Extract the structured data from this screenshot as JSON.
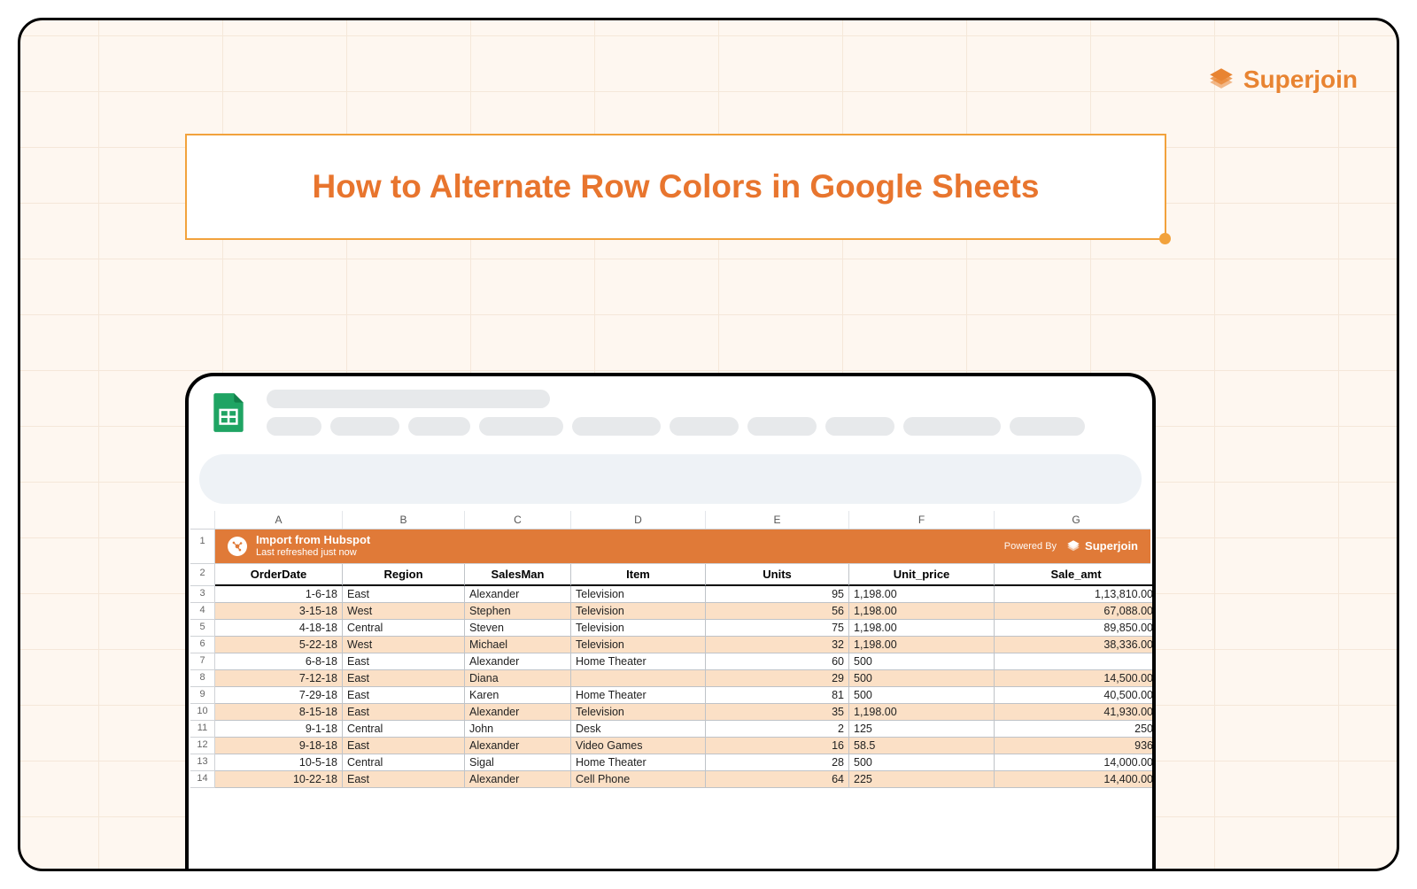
{
  "brand": {
    "name": "Superjoin"
  },
  "title": "How to Alternate Row Colors in Google Sheets",
  "columns": [
    "A",
    "B",
    "C",
    "D",
    "E",
    "F",
    "G"
  ],
  "banner": {
    "title": "Import from Hubspot",
    "subtitle": "Last refreshed just now",
    "powered_label": "Powered By",
    "powered_name": "Superjoin"
  },
  "headers": [
    "OrderDate",
    "Region",
    "SalesMan",
    "Item",
    "Units",
    "Unit_price",
    "Sale_amt"
  ],
  "rows": [
    {
      "n": 3,
      "d": "1-6-18",
      "r": "East",
      "s": "Alexander",
      "i": "Television",
      "u": "95",
      "p": "1,198.00",
      "a": "1,13,810.00"
    },
    {
      "n": 4,
      "d": "3-15-18",
      "r": "West",
      "s": "Stephen",
      "i": "Television",
      "u": "56",
      "p": "1,198.00",
      "a": "67,088.00"
    },
    {
      "n": 5,
      "d": "4-18-18",
      "r": "Central",
      "s": "Steven",
      "i": "Television",
      "u": "75",
      "p": "1,198.00",
      "a": "89,850.00"
    },
    {
      "n": 6,
      "d": "5-22-18",
      "r": "West",
      "s": "Michael",
      "i": "Television",
      "u": "32",
      "p": "1,198.00",
      "a": "38,336.00"
    },
    {
      "n": 7,
      "d": "6-8-18",
      "r": "East",
      "s": "Alexander",
      "i": "Home Theater",
      "u": "60",
      "p": "500",
      "a": ""
    },
    {
      "n": 8,
      "d": "7-12-18",
      "r": "East",
      "s": "Diana",
      "i": "",
      "u": "29",
      "p": "500",
      "a": "14,500.00"
    },
    {
      "n": 9,
      "d": "7-29-18",
      "r": "East",
      "s": "Karen",
      "i": "Home Theater",
      "u": "81",
      "p": "500",
      "a": "40,500.00"
    },
    {
      "n": 10,
      "d": "8-15-18",
      "r": "East",
      "s": "Alexander",
      "i": "Television",
      "u": "35",
      "p": "1,198.00",
      "a": "41,930.00"
    },
    {
      "n": 11,
      "d": "9-1-18",
      "r": "Central",
      "s": "John",
      "i": "Desk",
      "u": "2",
      "p": "125",
      "a": "250"
    },
    {
      "n": 12,
      "d": "9-18-18",
      "r": "East",
      "s": "Alexander",
      "i": "Video Games",
      "u": "16",
      "p": "58.5",
      "a": "936"
    },
    {
      "n": 13,
      "d": "10-5-18",
      "r": "Central",
      "s": "Sigal",
      "i": "Home Theater",
      "u": "28",
      "p": "500",
      "a": "14,000.00"
    },
    {
      "n": 14,
      "d": "10-22-18",
      "r": "East",
      "s": "Alexander",
      "i": "Cell Phone",
      "u": "64",
      "p": "225",
      "a": "14,400.00"
    }
  ],
  "menu_widths": [
    62,
    78,
    70,
    95,
    100,
    78,
    78,
    78,
    110,
    85
  ]
}
